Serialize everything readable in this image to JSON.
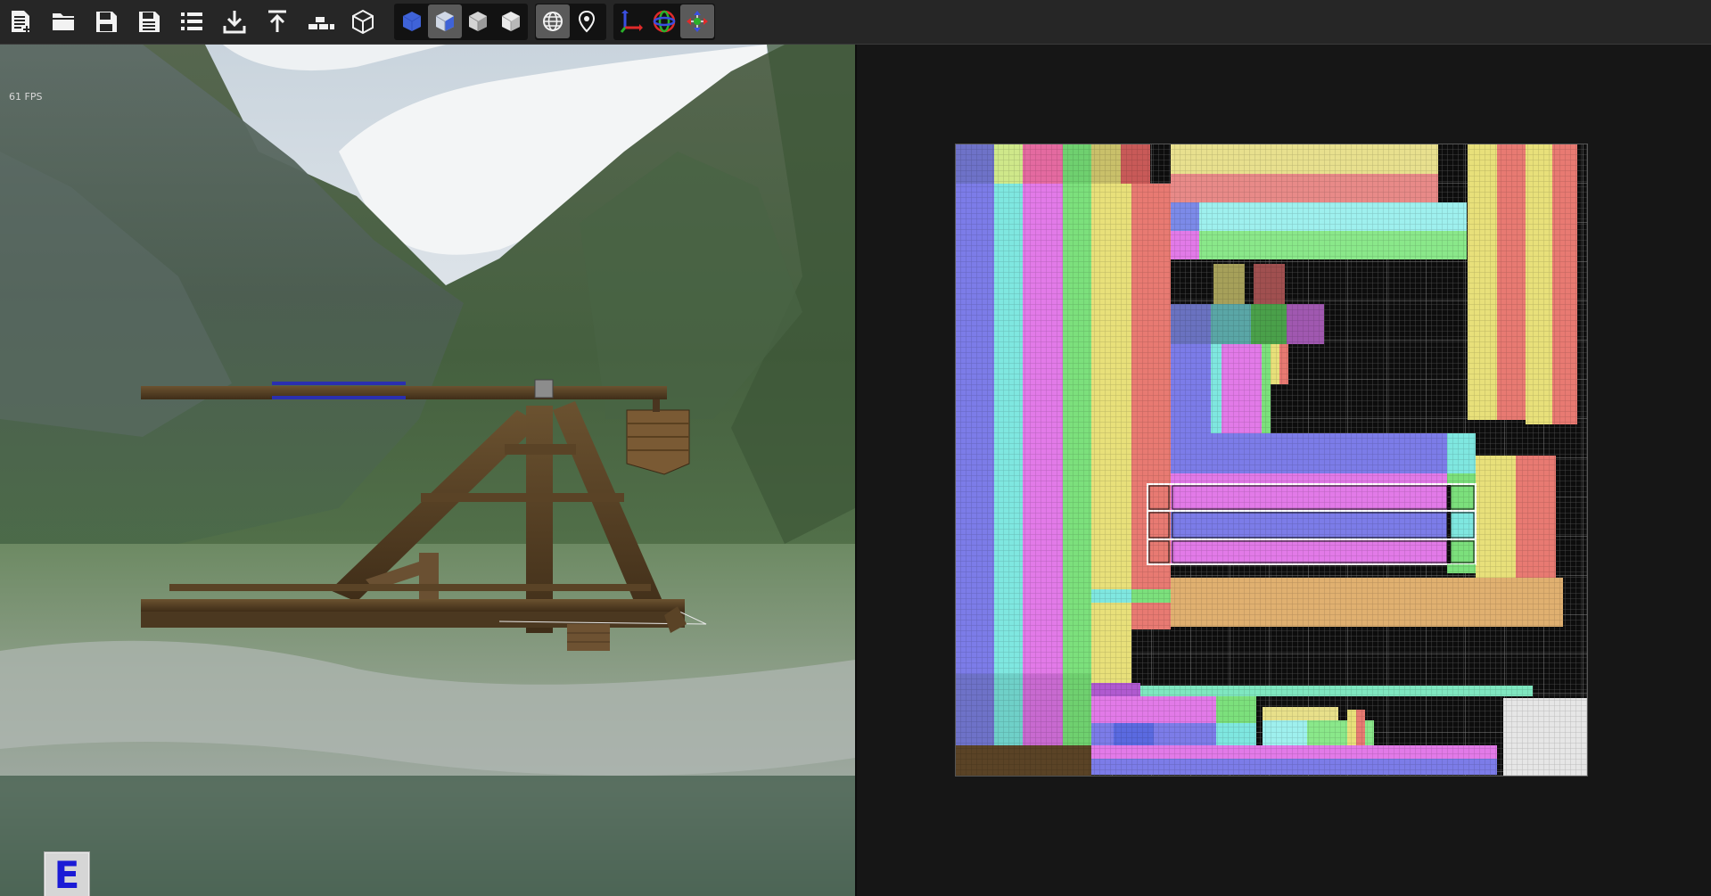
{
  "toolbar": {
    "file_tools": [
      {
        "name": "new-document-icon"
      },
      {
        "name": "open-folder-icon"
      },
      {
        "name": "save-icon"
      },
      {
        "name": "save-as-icon"
      },
      {
        "name": "list-icon"
      },
      {
        "name": "import-icon"
      },
      {
        "name": "export-icon"
      },
      {
        "name": "blocks-icon"
      },
      {
        "name": "cube-outline-icon"
      }
    ],
    "view_modes": [
      {
        "name": "solid-blue-cube-icon",
        "active": false
      },
      {
        "name": "textured-cube-icon",
        "active": true
      },
      {
        "name": "grey-cube-icon",
        "active": false
      },
      {
        "name": "white-cube-icon",
        "active": false
      }
    ],
    "world_tools": [
      {
        "name": "globe-icon"
      },
      {
        "name": "location-pin-icon"
      }
    ],
    "transform_tools": [
      {
        "name": "move-axes-icon",
        "active": false
      },
      {
        "name": "rotate-gizmo-icon",
        "active": false
      },
      {
        "name": "scale-gizmo-icon",
        "active": true
      }
    ]
  },
  "viewport": {
    "fps_label": "61 FPS",
    "key_hint": "E"
  },
  "colors": {
    "toolbar_bg": "#262626",
    "uv_bg": "#161616",
    "wood": "#5a4326",
    "uv_blue": "#7c7ce8",
    "uv_cyan": "#7fe7e0",
    "uv_magenta": "#e27ae8",
    "uv_green": "#7ce07c",
    "uv_yellow": "#e8e07a",
    "uv_red": "#e87a72",
    "uv_orange": "#e0b070"
  }
}
